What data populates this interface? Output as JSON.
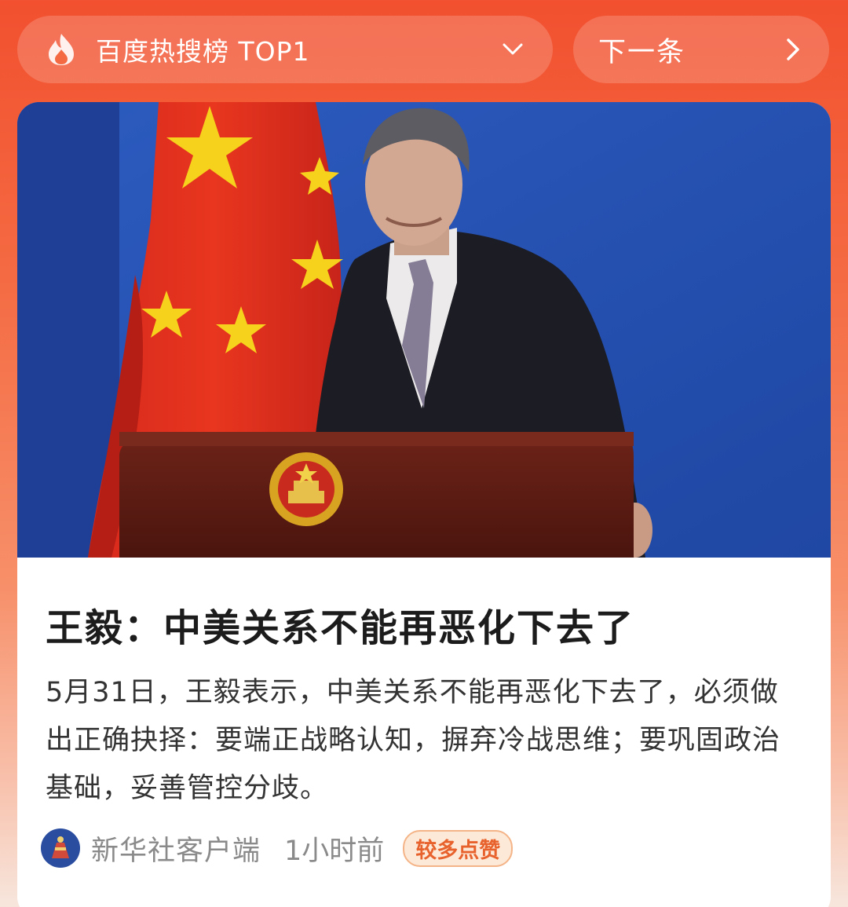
{
  "header": {
    "hot_list_title": "百度热搜榜 TOP1",
    "next_label": "下一条",
    "icons": [
      "flame-icon",
      "chevron-down-icon",
      "chevron-right-icon"
    ]
  },
  "article": {
    "headline": "王毅：中美关系不能再恶化下去了",
    "summary": "5月31日，王毅表示，中美关系不能再恶化下去了，必须做出正确抉择：要端正战略认知，摒弃冷战思维；要巩固政治基础，妥善管控分歧。",
    "source": "新华社客户端",
    "time": "1小时前",
    "badge": "较多点赞"
  },
  "colors": {
    "accent": "#f2502f",
    "badge_text": "#e7622c",
    "badge_bg": "#fde9d8"
  }
}
